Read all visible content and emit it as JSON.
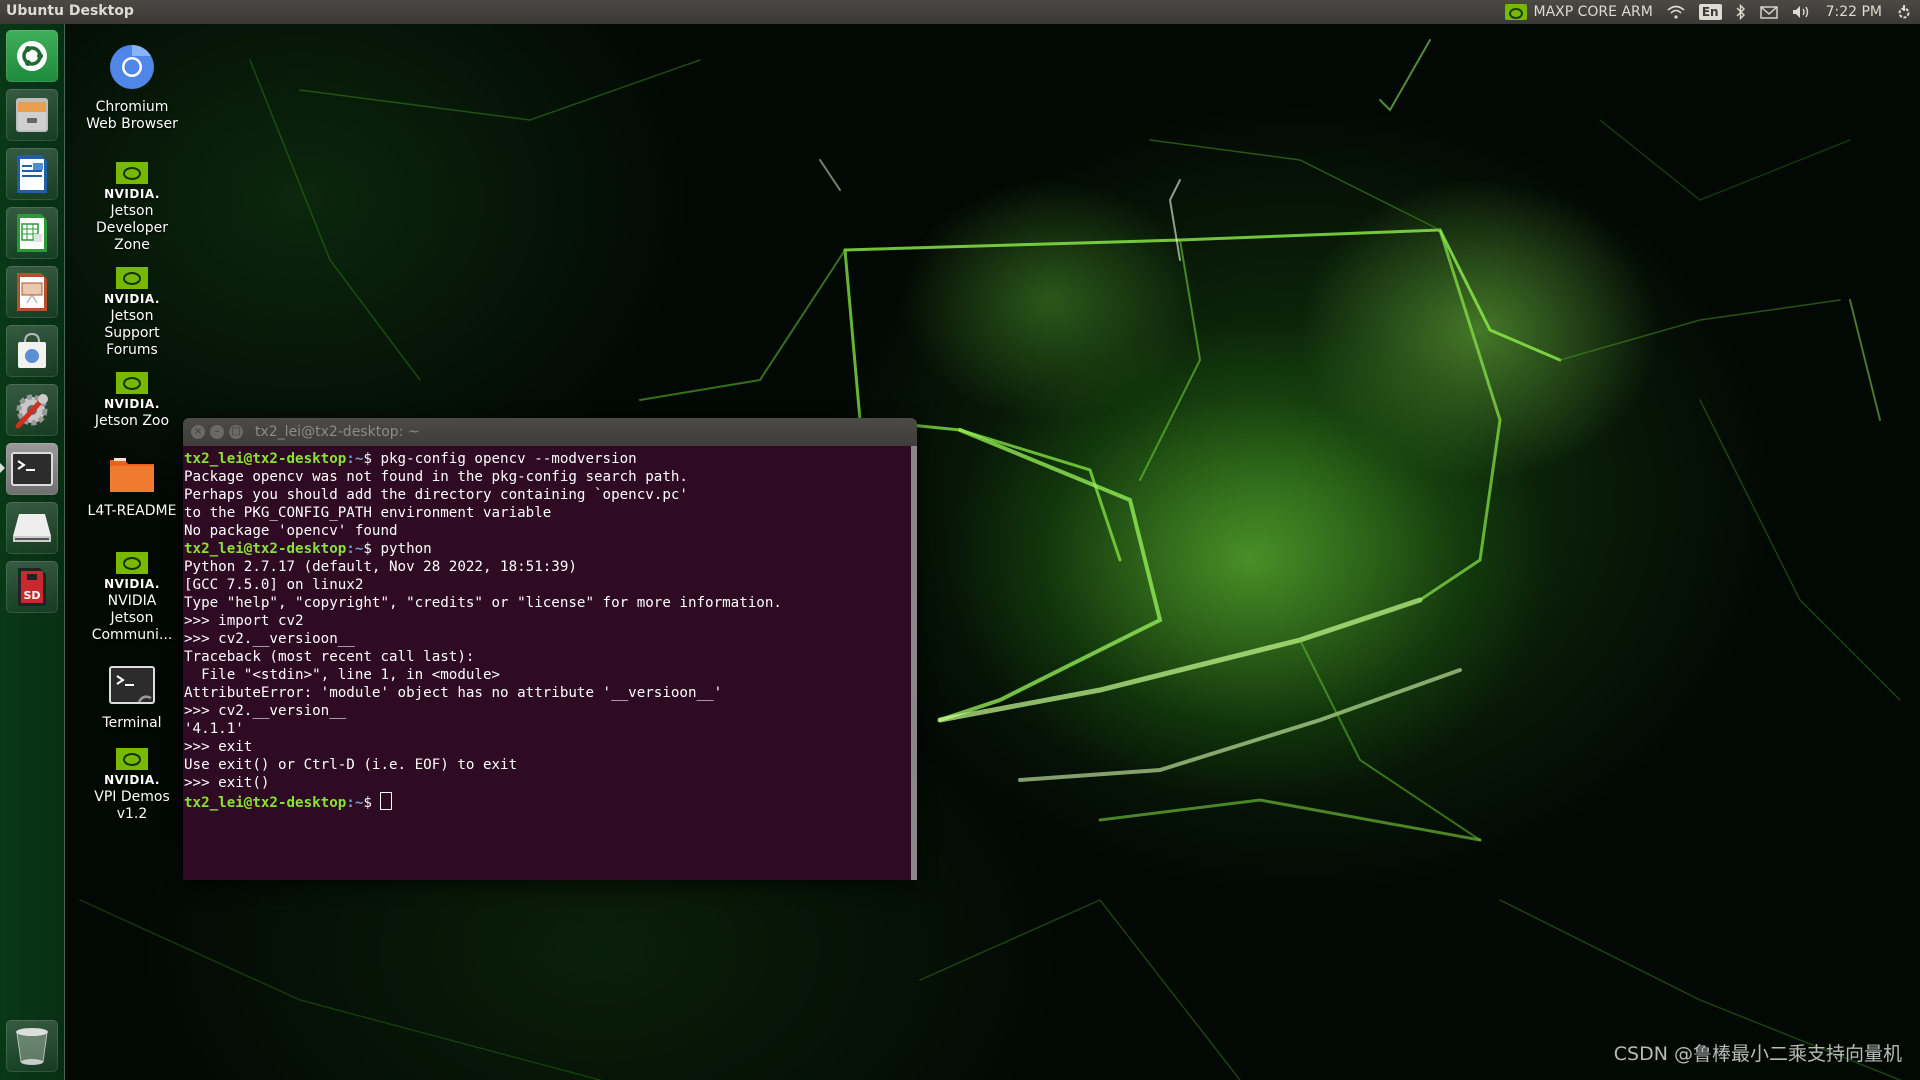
{
  "top_panel": {
    "title": "Ubuntu Desktop",
    "power_mode": "MAXP CORE ARM",
    "keyboard_layout": "En",
    "time": "7:22 PM",
    "indicators": [
      "nvidia-icon",
      "wifi-icon",
      "keyboard-icon",
      "bluetooth-icon",
      "mail-icon",
      "volume-icon",
      "clock",
      "power-gear-icon"
    ]
  },
  "launcher": {
    "items": [
      {
        "name": "ubuntu-dash",
        "icon": "ubuntu-logo-icon"
      },
      {
        "name": "files",
        "icon": "file-cabinet-icon"
      },
      {
        "name": "libreoffice-writer",
        "icon": "writer-icon"
      },
      {
        "name": "libreoffice-calc",
        "icon": "calc-icon"
      },
      {
        "name": "libreoffice-impress",
        "icon": "impress-icon"
      },
      {
        "name": "ubuntu-software",
        "icon": "shopping-bag-icon"
      },
      {
        "name": "system-settings",
        "icon": "settings-wrench-icon"
      },
      {
        "name": "terminal",
        "icon": "terminal-icon",
        "active": true
      },
      {
        "name": "drive",
        "icon": "drive-icon"
      },
      {
        "name": "sd-card",
        "icon": "sd-card-icon",
        "label": "SD"
      },
      {
        "name": "trash",
        "icon": "trash-icon"
      }
    ]
  },
  "desktop_icons": [
    {
      "label": "Chromium Web Browser",
      "icon": "chromium-icon"
    },
    {
      "label": "Jetson Developer Zone",
      "icon": "nvidia-icon",
      "brand": "NVIDIA."
    },
    {
      "label": "Jetson Support Forums",
      "icon": "nvidia-icon",
      "brand": "NVIDIA."
    },
    {
      "label": "Jetson Zoo",
      "icon": "nvidia-icon",
      "brand": "NVIDIA."
    },
    {
      "label": "L4T-README",
      "icon": "folder-icon"
    },
    {
      "label": "NVIDIA Jetson Communi...",
      "icon": "nvidia-icon",
      "brand": "NVIDIA."
    },
    {
      "label": "Terminal",
      "icon": "terminal-icon"
    },
    {
      "label": "VPI Demos v1.2",
      "icon": "nvidia-icon",
      "brand": "NVIDIA."
    }
  ],
  "terminal": {
    "title": "tx2_lei@tx2-desktop: ~",
    "prompt_user": "tx2_lei@tx2-desktop",
    "prompt_path": ":~",
    "prompt_symbol": "$",
    "lines": [
      {
        "type": "prompt",
        "cmd": " pkg-config opencv --modversion"
      },
      {
        "type": "out",
        "text": "Package opencv was not found in the pkg-config search path."
      },
      {
        "type": "out",
        "text": "Perhaps you should add the directory containing `opencv.pc'"
      },
      {
        "type": "out",
        "text": "to the PKG_CONFIG_PATH environment variable"
      },
      {
        "type": "out",
        "text": "No package 'opencv' found"
      },
      {
        "type": "prompt",
        "cmd": " python"
      },
      {
        "type": "out",
        "text": "Python 2.7.17 (default, Nov 28 2022, 18:51:39)"
      },
      {
        "type": "out",
        "text": "[GCC 7.5.0] on linux2"
      },
      {
        "type": "out",
        "text": "Type \"help\", \"copyright\", \"credits\" or \"license\" for more information."
      },
      {
        "type": "out",
        "text": ">>> import cv2"
      },
      {
        "type": "out",
        "text": ">>> cv2.__versioon__"
      },
      {
        "type": "out",
        "text": "Traceback (most recent call last):"
      },
      {
        "type": "out",
        "text": "  File \"<stdin>\", line 1, in <module>"
      },
      {
        "type": "out",
        "text": "AttributeError: 'module' object has no attribute '__versioon__'"
      },
      {
        "type": "out",
        "text": ">>> cv2.__version__"
      },
      {
        "type": "out",
        "text": "'4.1.1'"
      },
      {
        "type": "out",
        "text": ">>> exit"
      },
      {
        "type": "out",
        "text": "Use exit() or Ctrl-D (i.e. EOF) to exit"
      },
      {
        "type": "out",
        "text": ">>> exit()"
      },
      {
        "type": "prompt",
        "cmd": " ",
        "cursor": true
      }
    ]
  },
  "watermark": "CSDN @鲁棒最小二乘支持向量机",
  "colors": {
    "terminal_bg": "#300a24",
    "prompt_user": "#8ae234",
    "prompt_path": "#729fcf",
    "nvidia_green": "#76b900",
    "panel_bg": "#3c3b37"
  }
}
